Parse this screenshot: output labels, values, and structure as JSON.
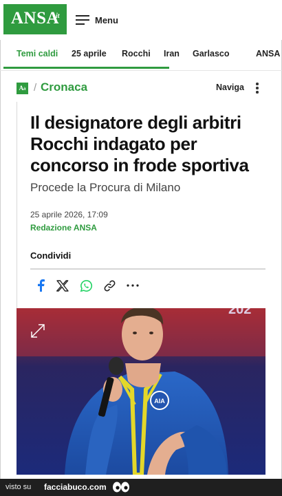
{
  "header": {
    "logo_text": "ANSA",
    "logo_suffix": "it",
    "menu_label": "Menu"
  },
  "topics": {
    "items": [
      "Temi caldi",
      "25 aprile",
      "Rocchi",
      "Iran",
      "Garlasco",
      "ANSA"
    ]
  },
  "section": {
    "logo_text": "A",
    "logo_suffix": "it",
    "separator": "/",
    "name": "Cronaca",
    "naviga_label": "Naviga"
  },
  "article": {
    "title": "Il designatore degli arbitri Rocchi indagato per concorso in frode sportiva",
    "subtitle": "Procede la Procura di Milano",
    "date": "25 aprile 2026, 17:09",
    "author": "Redazione ANSA",
    "share_label": "Condividi"
  },
  "share_icons": [
    "facebook-icon",
    "x-icon",
    "whatsapp-icon",
    "link-icon",
    "more-icon"
  ],
  "photo": {
    "badge_text": "AIA",
    "bg_text": "202"
  },
  "footer": {
    "visto_label": "visto su",
    "brand": "facciabuco.com"
  },
  "colors": {
    "accent": "#2f9b3f",
    "footer_bg": "#1f1f1f",
    "facebook": "#1877f2",
    "whatsapp": "#25d366"
  }
}
